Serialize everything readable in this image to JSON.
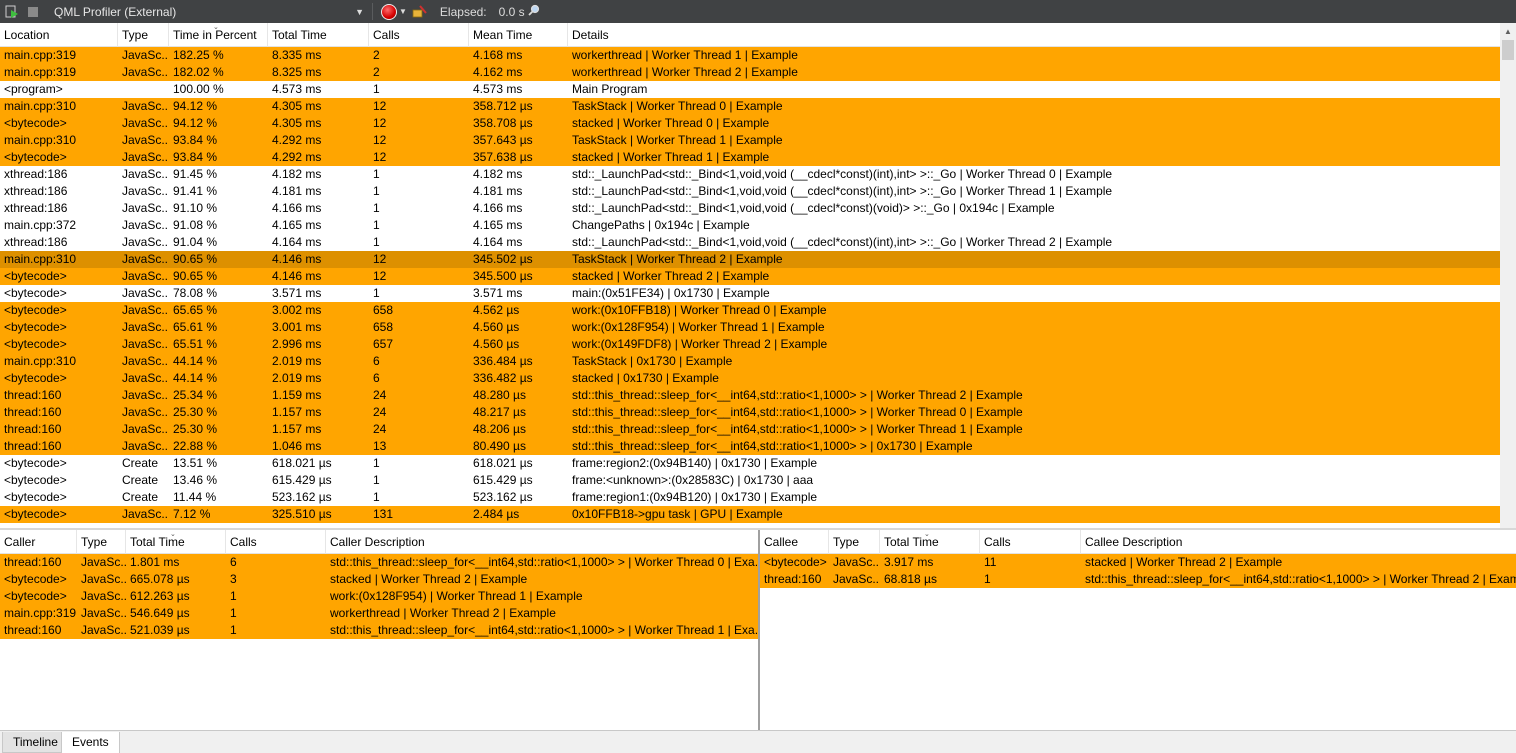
{
  "toolbar": {
    "tool_name": "QML Profiler (External)",
    "elapsed_label": "Elapsed:",
    "elapsed_value": "0.0 s"
  },
  "main": {
    "columns": [
      "Location",
      "Type",
      "Time in Percent",
      "Total Time",
      "Calls",
      "Mean Time",
      "Details"
    ],
    "rows": [
      {
        "location": "main.cpp:319",
        "type": "JavaSc...",
        "percent": "182.25 %",
        "total": "8.335 ms",
        "calls": "2",
        "mean": "4.168 ms",
        "details": "workerthread | Worker Thread 1 | Example",
        "style": "orange"
      },
      {
        "location": "main.cpp:319",
        "type": "JavaSc...",
        "percent": "182.02 %",
        "total": "8.325 ms",
        "calls": "2",
        "mean": "4.162 ms",
        "details": "workerthread | Worker Thread 2 | Example",
        "style": "orange"
      },
      {
        "location": "<program>",
        "type": "",
        "percent": "100.00 %",
        "total": "4.573 ms",
        "calls": "1",
        "mean": "4.573 ms",
        "details": "Main Program",
        "style": "white"
      },
      {
        "location": "main.cpp:310",
        "type": "JavaSc...",
        "percent": "94.12 %",
        "total": "4.305 ms",
        "calls": "12",
        "mean": "358.712 µs",
        "details": "TaskStack | Worker Thread 0 | Example",
        "style": "orange"
      },
      {
        "location": "<bytecode>",
        "type": "JavaSc...",
        "percent": "94.12 %",
        "total": "4.305 ms",
        "calls": "12",
        "mean": "358.708 µs",
        "details": "stacked | Worker Thread 0 | Example",
        "style": "orange"
      },
      {
        "location": "main.cpp:310",
        "type": "JavaSc...",
        "percent": "93.84 %",
        "total": "4.292 ms",
        "calls": "12",
        "mean": "357.643 µs",
        "details": "TaskStack | Worker Thread 1 | Example",
        "style": "orange"
      },
      {
        "location": "<bytecode>",
        "type": "JavaSc...",
        "percent": "93.84 %",
        "total": "4.292 ms",
        "calls": "12",
        "mean": "357.638 µs",
        "details": "stacked | Worker Thread 1 | Example",
        "style": "orange"
      },
      {
        "location": "xthread:186",
        "type": "JavaSc...",
        "percent": "91.45 %",
        "total": "4.182 ms",
        "calls": "1",
        "mean": "4.182 ms",
        "details": "std::_LaunchPad<std::_Bind<1,void,void (__cdecl*const)(int),int> >::_Go | Worker Thread 0 | Example",
        "style": "white"
      },
      {
        "location": "xthread:186",
        "type": "JavaSc...",
        "percent": "91.41 %",
        "total": "4.181 ms",
        "calls": "1",
        "mean": "4.181 ms",
        "details": "std::_LaunchPad<std::_Bind<1,void,void (__cdecl*const)(int),int> >::_Go | Worker Thread 1 | Example",
        "style": "white"
      },
      {
        "location": "xthread:186",
        "type": "JavaSc...",
        "percent": "91.10 %",
        "total": "4.166 ms",
        "calls": "1",
        "mean": "4.166 ms",
        "details": "std::_LaunchPad<std::_Bind<1,void,void (__cdecl*const)(void)> >::_Go | 0x194c | Example",
        "style": "white"
      },
      {
        "location": "main.cpp:372",
        "type": "JavaSc...",
        "percent": "91.08 %",
        "total": "4.165 ms",
        "calls": "1",
        "mean": "4.165 ms",
        "details": "ChangePaths | 0x194c | Example",
        "style": "white"
      },
      {
        "location": "xthread:186",
        "type": "JavaSc...",
        "percent": "91.04 %",
        "total": "4.164 ms",
        "calls": "1",
        "mean": "4.164 ms",
        "details": "std::_LaunchPad<std::_Bind<1,void,void (__cdecl*const)(int),int> >::_Go | Worker Thread 2 | Example",
        "style": "white"
      },
      {
        "location": "main.cpp:310",
        "type": "JavaSc...",
        "percent": "90.65 %",
        "total": "4.146 ms",
        "calls": "12",
        "mean": "345.502 µs",
        "details": "TaskStack | Worker Thread 2 | Example",
        "style": "selected"
      },
      {
        "location": "<bytecode>",
        "type": "JavaSc...",
        "percent": "90.65 %",
        "total": "4.146 ms",
        "calls": "12",
        "mean": "345.500 µs",
        "details": "stacked | Worker Thread 2 | Example",
        "style": "orange"
      },
      {
        "location": "<bytecode>",
        "type": "JavaSc...",
        "percent": "78.08 %",
        "total": "3.571 ms",
        "calls": "1",
        "mean": "3.571 ms",
        "details": "main:(0x51FE34) | 0x1730 | Example",
        "style": "white"
      },
      {
        "location": "<bytecode>",
        "type": "JavaSc...",
        "percent": "65.65 %",
        "total": "3.002 ms",
        "calls": "658",
        "mean": "4.562 µs",
        "details": "work:(0x10FFB18) | Worker Thread 0 | Example",
        "style": "orange"
      },
      {
        "location": "<bytecode>",
        "type": "JavaSc...",
        "percent": "65.61 %",
        "total": "3.001 ms",
        "calls": "658",
        "mean": "4.560 µs",
        "details": "work:(0x128F954) | Worker Thread 1 | Example",
        "style": "orange"
      },
      {
        "location": "<bytecode>",
        "type": "JavaSc...",
        "percent": "65.51 %",
        "total": "2.996 ms",
        "calls": "657",
        "mean": "4.560 µs",
        "details": "work:(0x149FDF8) | Worker Thread 2 | Example",
        "style": "orange"
      },
      {
        "location": "main.cpp:310",
        "type": "JavaSc...",
        "percent": "44.14 %",
        "total": "2.019 ms",
        "calls": "6",
        "mean": "336.484 µs",
        "details": "TaskStack | 0x1730 | Example",
        "style": "orange"
      },
      {
        "location": "<bytecode>",
        "type": "JavaSc...",
        "percent": "44.14 %",
        "total": "2.019 ms",
        "calls": "6",
        "mean": "336.482 µs",
        "details": "stacked | 0x1730 | Example",
        "style": "orange"
      },
      {
        "location": "thread:160",
        "type": "JavaSc...",
        "percent": "25.34 %",
        "total": "1.159 ms",
        "calls": "24",
        "mean": "48.280 µs",
        "details": "std::this_thread::sleep_for<__int64,std::ratio<1,1000> > | Worker Thread 2 | Example",
        "style": "orange"
      },
      {
        "location": "thread:160",
        "type": "JavaSc...",
        "percent": "25.30 %",
        "total": "1.157 ms",
        "calls": "24",
        "mean": "48.217 µs",
        "details": "std::this_thread::sleep_for<__int64,std::ratio<1,1000> > | Worker Thread 0 | Example",
        "style": "orange"
      },
      {
        "location": "thread:160",
        "type": "JavaSc...",
        "percent": "25.30 %",
        "total": "1.157 ms",
        "calls": "24",
        "mean": "48.206 µs",
        "details": "std::this_thread::sleep_for<__int64,std::ratio<1,1000> > | Worker Thread 1 | Example",
        "style": "orange"
      },
      {
        "location": "thread:160",
        "type": "JavaSc...",
        "percent": "22.88 %",
        "total": "1.046 ms",
        "calls": "13",
        "mean": "80.490 µs",
        "details": "std::this_thread::sleep_for<__int64,std::ratio<1,1000> > | 0x1730 | Example",
        "style": "orange"
      },
      {
        "location": "<bytecode>",
        "type": "Create",
        "percent": "13.51 %",
        "total": "618.021 µs",
        "calls": "1",
        "mean": "618.021 µs",
        "details": "frame:region2:(0x94B140) | 0x1730 | Example",
        "style": "white"
      },
      {
        "location": "<bytecode>",
        "type": "Create",
        "percent": "13.46 %",
        "total": "615.429 µs",
        "calls": "1",
        "mean": "615.429 µs",
        "details": "frame:<unknown>:(0x28583C) | 0x1730 | aaa",
        "style": "white"
      },
      {
        "location": "<bytecode>",
        "type": "Create",
        "percent": "11.44 %",
        "total": "523.162 µs",
        "calls": "1",
        "mean": "523.162 µs",
        "details": "frame:region1:(0x94B120) | 0x1730 | Example",
        "style": "white"
      },
      {
        "location": "<bytecode>",
        "type": "JavaSc...",
        "percent": "7.12 %",
        "total": "325.510 µs",
        "calls": "131",
        "mean": "2.484 µs",
        "details": "0x10FFB18->gpu task | GPU | Example",
        "style": "orange"
      }
    ]
  },
  "caller": {
    "columns": [
      "Caller",
      "Type",
      "Total Time",
      "Calls",
      "Caller Description"
    ],
    "rows": [
      {
        "name": "thread:160",
        "type": "JavaSc...",
        "total": "1.801 ms",
        "calls": "6",
        "desc": "std::this_thread::sleep_for<__int64,std::ratio<1,1000> > | Worker Thread 0 | Exa..."
      },
      {
        "name": "<bytecode>",
        "type": "JavaSc...",
        "total": "665.078 µs",
        "calls": "3",
        "desc": "stacked | Worker Thread 2 | Example"
      },
      {
        "name": "<bytecode>",
        "type": "JavaSc...",
        "total": "612.263 µs",
        "calls": "1",
        "desc": "work:(0x128F954) | Worker Thread 1 | Example"
      },
      {
        "name": "main.cpp:319",
        "type": "JavaSc...",
        "total": "546.649 µs",
        "calls": "1",
        "desc": "workerthread | Worker Thread 2 | Example"
      },
      {
        "name": "thread:160",
        "type": "JavaSc...",
        "total": "521.039 µs",
        "calls": "1",
        "desc": "std::this_thread::sleep_for<__int64,std::ratio<1,1000> > | Worker Thread 1 | Exa..."
      }
    ]
  },
  "callee": {
    "columns": [
      "Callee",
      "Type",
      "Total Time",
      "Calls",
      "Callee Description"
    ],
    "rows": [
      {
        "name": "<bytecode>",
        "type": "JavaSc...",
        "total": "3.917 ms",
        "calls": "11",
        "desc": "stacked | Worker Thread 2 | Example"
      },
      {
        "name": "thread:160",
        "type": "JavaSc...",
        "total": "68.818 µs",
        "calls": "1",
        "desc": "std::this_thread::sleep_for<__int64,std::ratio<1,1000> > | Worker Thread 2 | Exam..."
      }
    ]
  },
  "tabs": [
    "Timeline",
    "Events"
  ],
  "colors": {
    "row_orange": "#ffa500",
    "row_selected": "#dd9000",
    "toolbar": "#404244"
  }
}
